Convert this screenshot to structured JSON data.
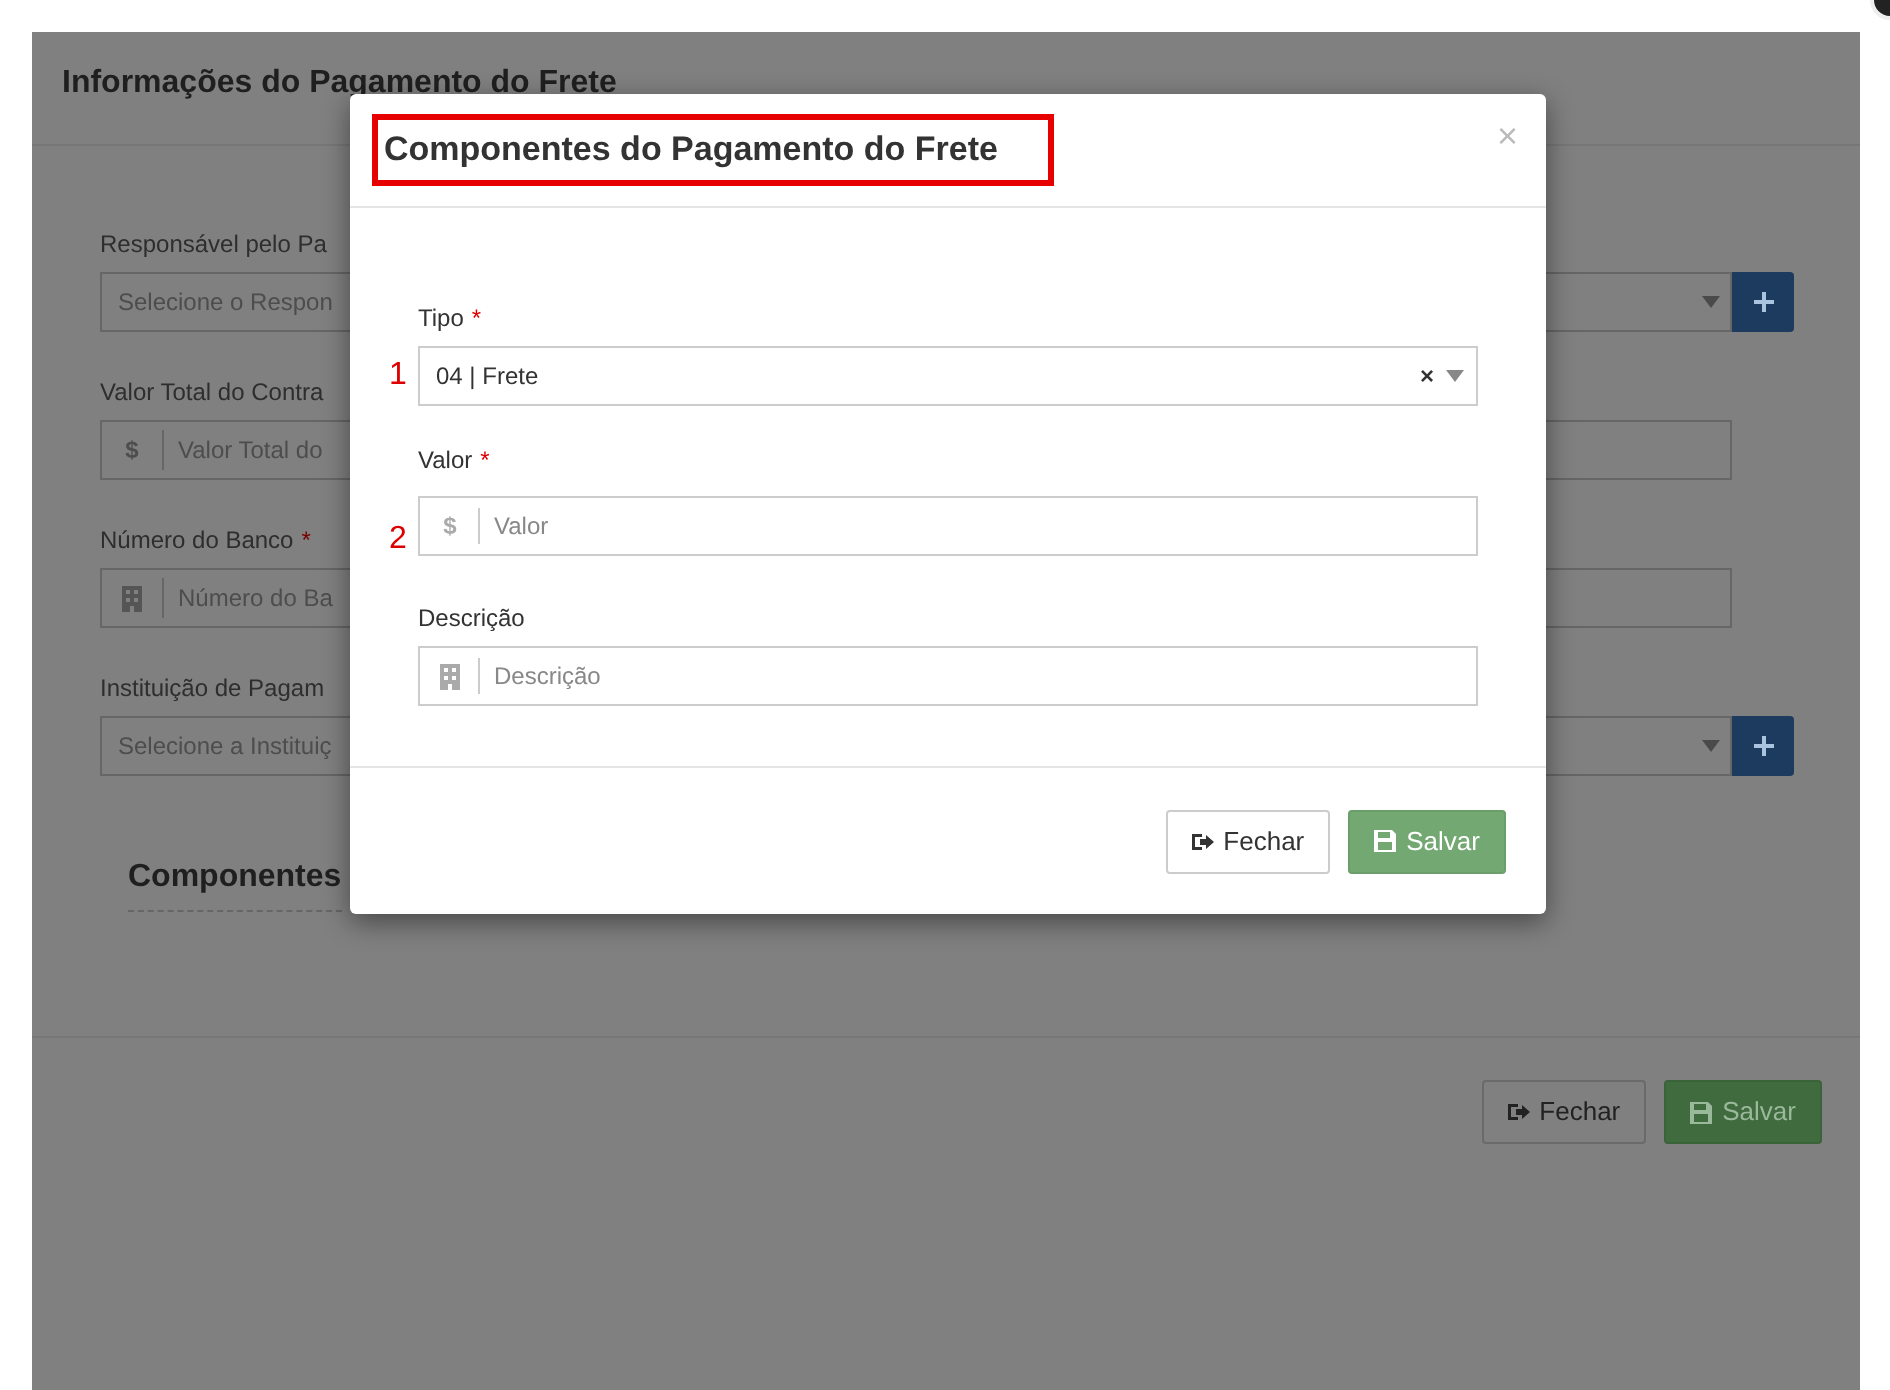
{
  "page": {
    "title": "Informações do Pagamento do Frete",
    "fields": [
      {
        "kind": "select",
        "label": "Responsável pelo Pa",
        "placeholder": "Selecione o Respon",
        "addable": true
      },
      {
        "kind": "money",
        "label": "Valor Total do Contra",
        "prefix": "$",
        "placeholder": "Valor Total do",
        "addable": false
      },
      {
        "kind": "text",
        "label": "Número do Banco",
        "required_mark": "*",
        "placeholder": "Número do Ba",
        "addable": false
      },
      {
        "kind": "select",
        "label": "Instituição de Pagam",
        "placeholder": "Selecione a Instituiç",
        "addable": true
      }
    ],
    "section_title": "Componentes",
    "buttons": [
      {
        "label": "Fechar",
        "kind": "default"
      },
      {
        "label": "Salvar",
        "kind": "success"
      }
    ]
  },
  "modal": {
    "title": "Componentes do Pagamento do Frete",
    "highlighted": true,
    "close": "×",
    "fields": [
      {
        "kind": "select",
        "label": "Tipo",
        "required_mark": "*",
        "value": "04 | Frete",
        "clear": "×",
        "marker": "1"
      },
      {
        "kind": "money",
        "label": "Valor",
        "required_mark": "*",
        "prefix": "$",
        "placeholder": "Valor",
        "marker": "2"
      },
      {
        "kind": "text",
        "label": "Descrição",
        "placeholder": "Descrição"
      }
    ],
    "buttons": [
      {
        "label": "Fechar",
        "kind": "default"
      },
      {
        "label": "Salvar",
        "kind": "success"
      }
    ]
  }
}
